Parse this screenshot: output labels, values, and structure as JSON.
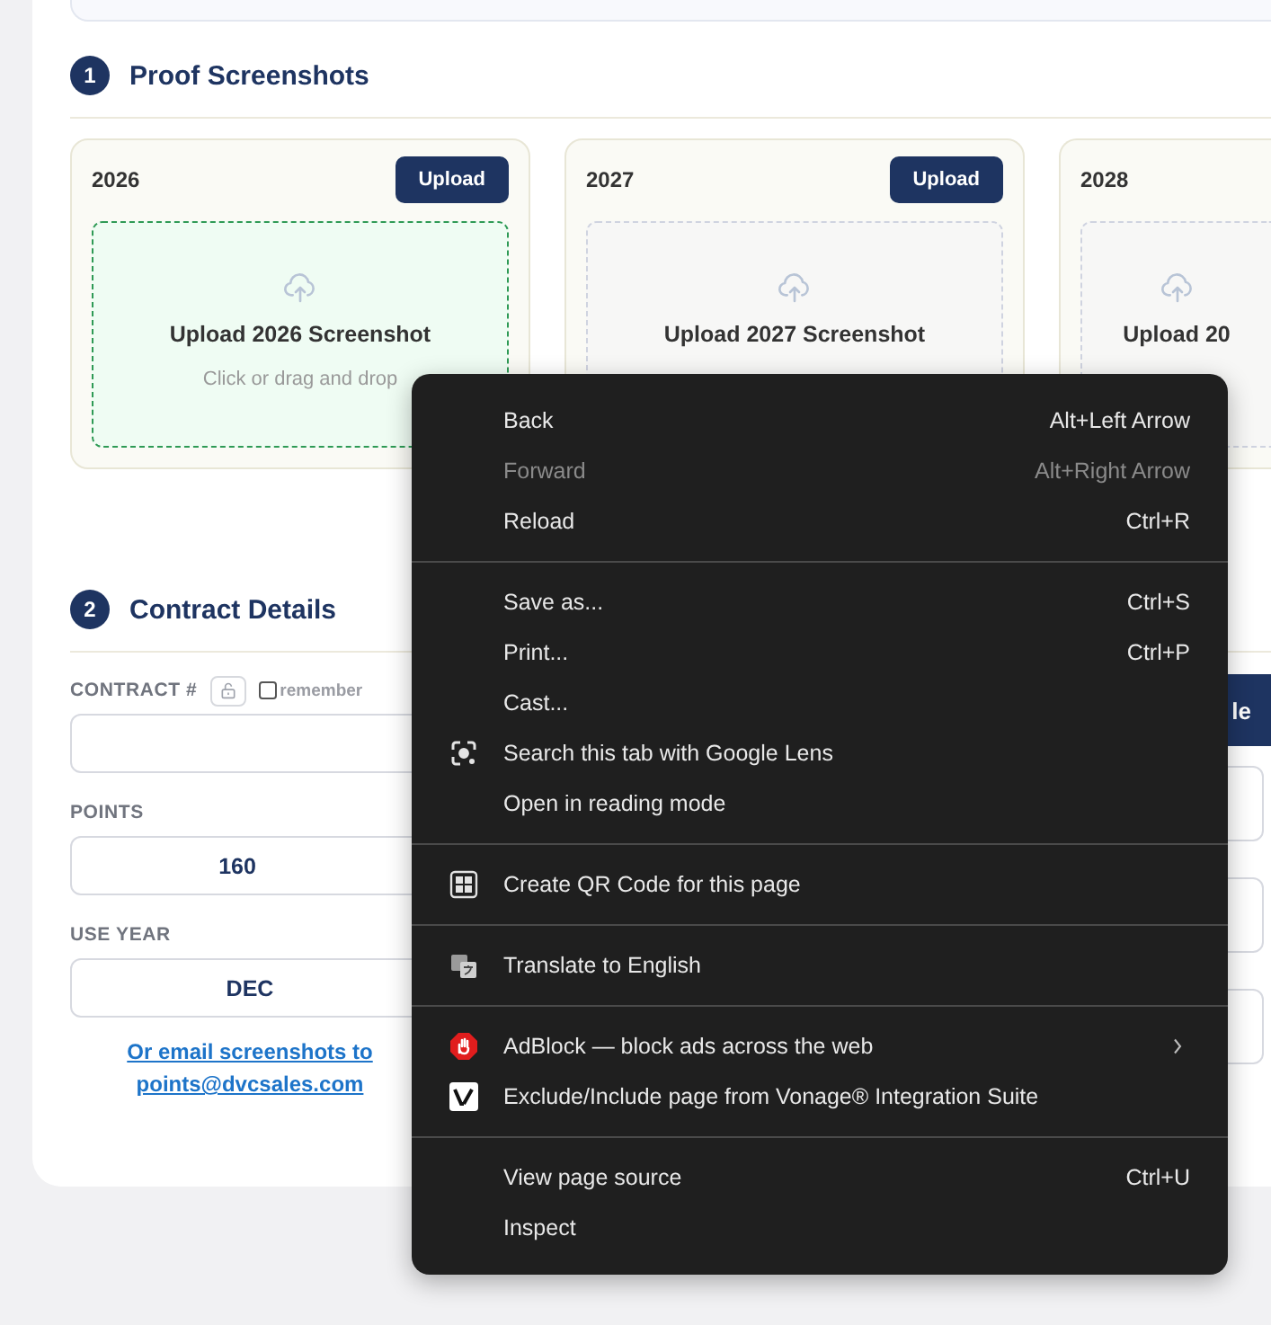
{
  "proof": {
    "step": "1",
    "title": "Proof Screenshots",
    "cards": [
      {
        "year": "2026",
        "button": "Upload",
        "drop_title": "Upload 2026 Screenshot",
        "drop_hint": "Click or drag and drop",
        "highlighted": true
      },
      {
        "year": "2027",
        "button": "Upload",
        "drop_title": "Upload 2027 Screenshot",
        "highlighted": false
      },
      {
        "year": "2028",
        "drop_title": "Upload 20",
        "highlighted": false
      }
    ]
  },
  "contract": {
    "step": "2",
    "title": "Contract Details",
    "contract_label": "CONTRACT #",
    "remember": {
      "label": "remember",
      "checked": false
    },
    "points_label": "POINTS",
    "points_value": "160",
    "use_year_label": "USE YEAR",
    "use_year_value": "DEC",
    "email_link": "Or email screenshots to points@dvcsales.com",
    "right_button": "le"
  },
  "context_menu": {
    "groups": [
      {
        "items": [
          {
            "kind": "plain",
            "label": "Back",
            "shortcut": "Alt+Left Arrow",
            "disabled": false
          },
          {
            "kind": "plain",
            "label": "Forward",
            "shortcut": "Alt+Right Arrow",
            "disabled": true
          },
          {
            "kind": "plain",
            "label": "Reload",
            "shortcut": "Ctrl+R",
            "disabled": false
          }
        ]
      },
      {
        "items": [
          {
            "kind": "plain",
            "label": "Save as...",
            "shortcut": "Ctrl+S",
            "disabled": false
          },
          {
            "kind": "plain",
            "label": "Print...",
            "shortcut": "Ctrl+P",
            "disabled": false
          },
          {
            "kind": "plain",
            "label": "Cast...",
            "disabled": false
          },
          {
            "kind": "lens",
            "label": "Search this tab with Google Lens",
            "disabled": false
          },
          {
            "kind": "plain",
            "label": "Open in reading mode",
            "disabled": false
          }
        ]
      },
      {
        "items": [
          {
            "kind": "qr",
            "label": "Create QR Code for this page",
            "disabled": false
          }
        ]
      },
      {
        "items": [
          {
            "kind": "translate",
            "label": "Translate to English",
            "disabled": false
          }
        ]
      },
      {
        "items": [
          {
            "kind": "adblock",
            "label": "AdBlock — block ads across the web",
            "disabled": false,
            "submenu": true
          },
          {
            "kind": "vonage",
            "label": "Exclude/Include page from Vonage® Integration Suite",
            "disabled": false
          }
        ]
      },
      {
        "items": [
          {
            "kind": "plain",
            "label": "View page source",
            "shortcut": "Ctrl+U",
            "disabled": false
          },
          {
            "kind": "plain",
            "label": "Inspect",
            "disabled": false
          }
        ]
      }
    ]
  }
}
